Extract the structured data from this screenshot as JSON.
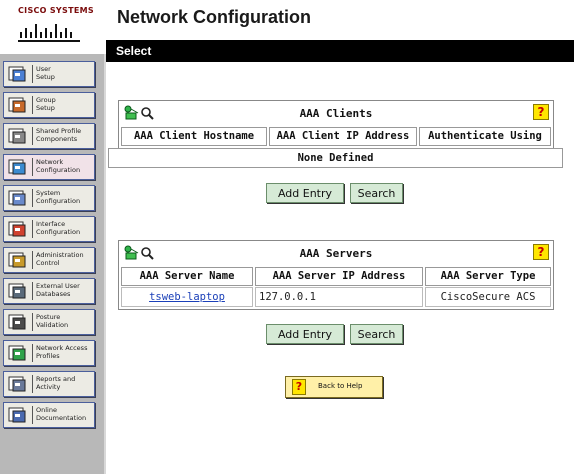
{
  "brand": {
    "name": "Cisco Systems"
  },
  "header": {
    "title": "Network Configuration"
  },
  "section_bar": {
    "label": "Select"
  },
  "sidebar": {
    "items": [
      {
        "label": "User\nSetup",
        "icon": "user-setup-icon"
      },
      {
        "label": "Group\nSetup",
        "icon": "group-setup-icon"
      },
      {
        "label": "Shared Profile\nComponents",
        "icon": "shared-profile-icon"
      },
      {
        "label": "Network\nConfiguration",
        "icon": "network-config-icon",
        "active": true
      },
      {
        "label": "System\nConfiguration",
        "icon": "system-config-icon"
      },
      {
        "label": "Interface\nConfiguration",
        "icon": "interface-config-icon"
      },
      {
        "label": "Administration\nControl",
        "icon": "admin-control-icon"
      },
      {
        "label": "External User\nDatabases",
        "icon": "external-db-icon"
      },
      {
        "label": "Posture\nValidation",
        "icon": "posture-icon"
      },
      {
        "label": "Network Access\nProfiles",
        "icon": "nap-icon"
      },
      {
        "label": "Reports and\nActivity",
        "icon": "reports-icon"
      },
      {
        "label": "Online\nDocumentation",
        "icon": "online-doc-icon"
      }
    ]
  },
  "aaa_clients": {
    "title": "AAA Clients",
    "columns": [
      "AAA Client Hostname",
      "AAA Client IP Address",
      "Authenticate Using"
    ],
    "empty_text": "None Defined",
    "add_label": "Add Entry",
    "search_label": "Search"
  },
  "aaa_servers": {
    "title": "AAA Servers",
    "columns": [
      "AAA Server Name",
      "AAA Server IP Address",
      "AAA Server Type"
    ],
    "rows": [
      {
        "name": "tsweb-laptop",
        "ip": "127.0.0.1",
        "type": "CiscoSecure ACS"
      }
    ],
    "add_label": "Add Entry",
    "search_label": "Search"
  },
  "help_button": {
    "label": "Back to Help"
  },
  "colors": {
    "accent_bar": "#000000",
    "nav_bg": "#b8b8b8",
    "button_bg": "#d6ead6",
    "help_yellow": "#ffe600"
  }
}
